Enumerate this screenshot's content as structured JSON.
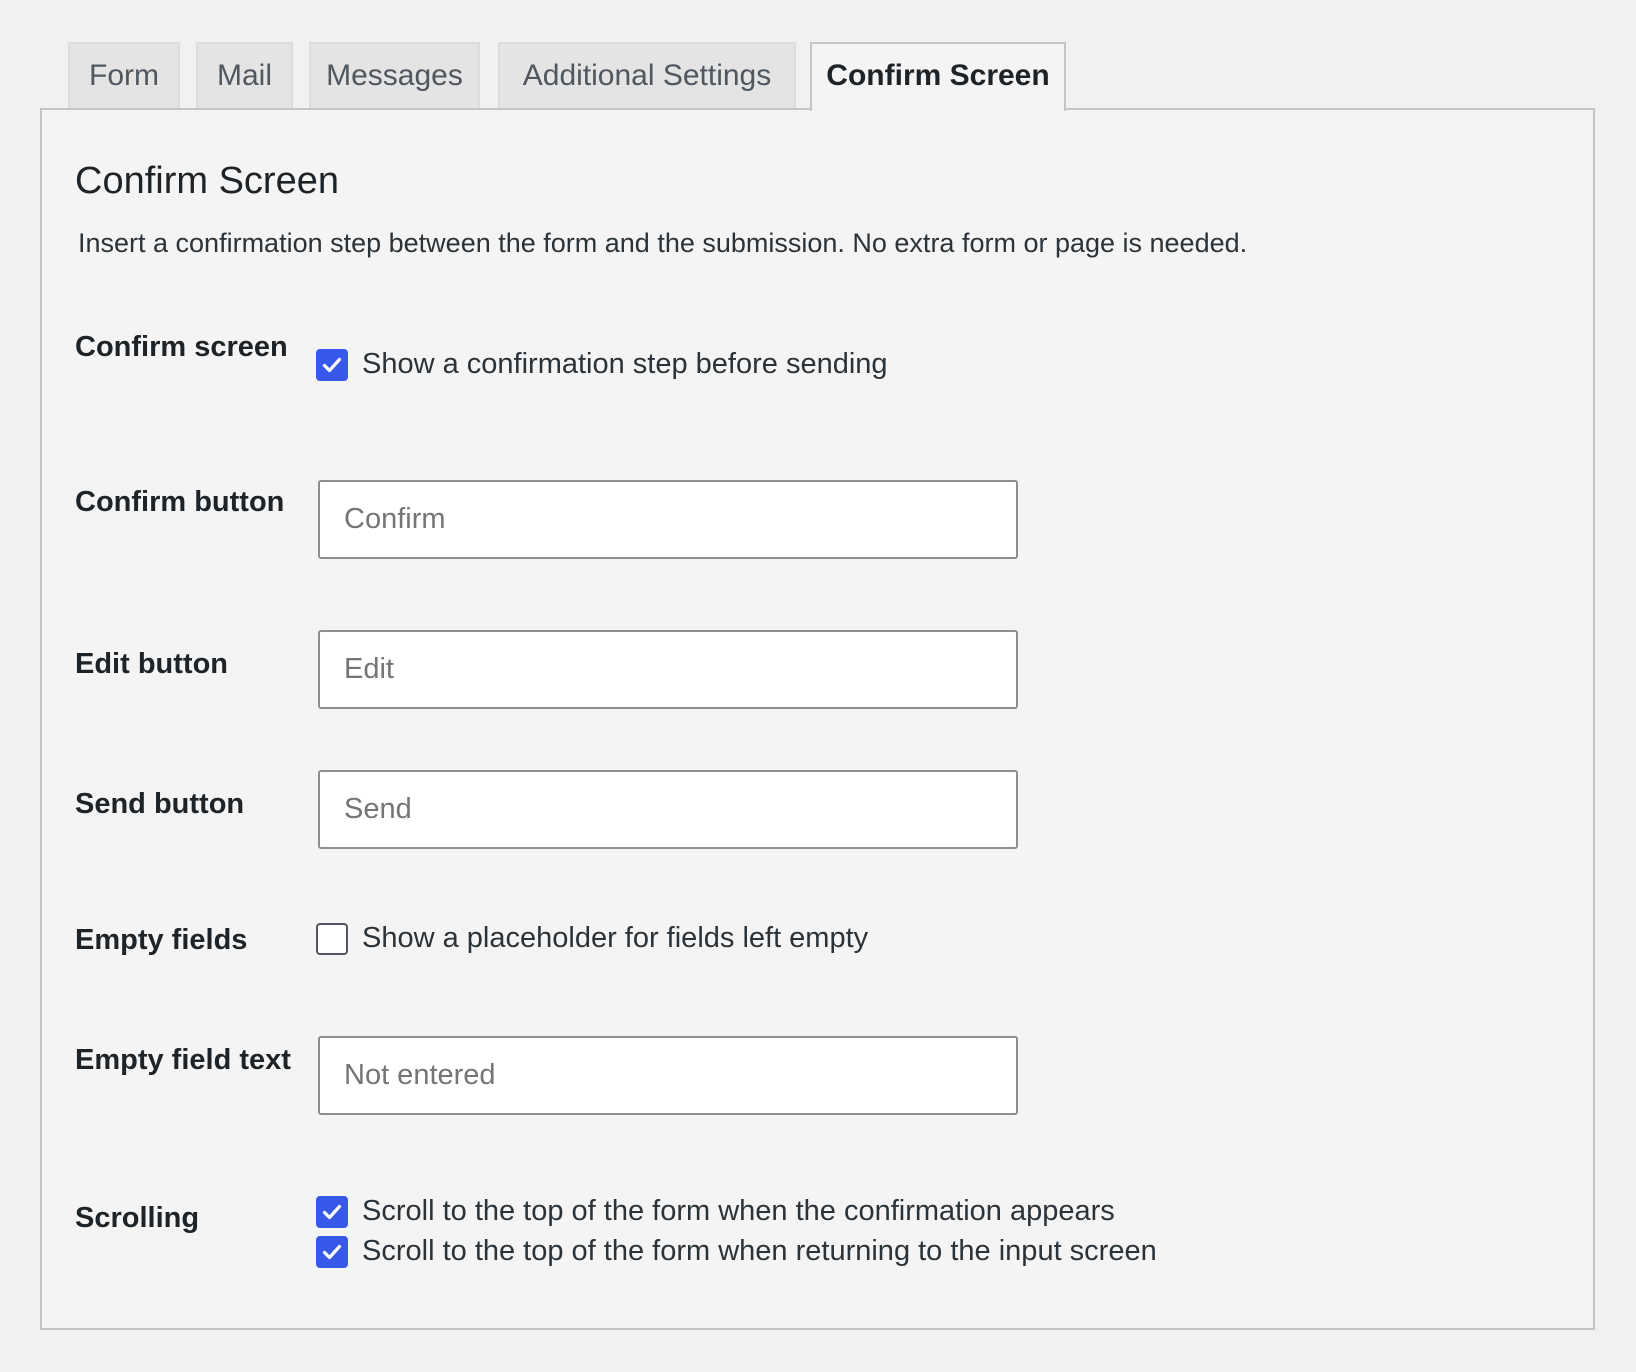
{
  "tabs": [
    {
      "label": "Form",
      "active": false
    },
    {
      "label": "Mail",
      "active": false
    },
    {
      "label": "Messages",
      "active": false
    },
    {
      "label": "Additional Settings",
      "active": false
    },
    {
      "label": "Confirm Screen",
      "active": true
    }
  ],
  "panel": {
    "title": "Confirm Screen",
    "description": "Insert a confirmation step between the form and the submission. No extra form or page is needed."
  },
  "fields": {
    "confirm_screen": {
      "label": "Confirm screen",
      "option": "Show a confirmation step before sending",
      "checked": true
    },
    "confirm_button": {
      "label": "Confirm button",
      "placeholder": "Confirm",
      "value": ""
    },
    "edit_button": {
      "label": "Edit button",
      "placeholder": "Edit",
      "value": ""
    },
    "send_button": {
      "label": "Send button",
      "placeholder": "Send",
      "value": ""
    },
    "empty_fields": {
      "label": "Empty fields",
      "option": "Show a placeholder for fields left empty",
      "checked": false
    },
    "empty_field_text": {
      "label": "Empty field text",
      "placeholder": "Not entered",
      "value": ""
    },
    "scrolling": {
      "label": "Scrolling",
      "options": [
        {
          "label": "Scroll to the top of the form when the confirmation appears",
          "checked": true
        },
        {
          "label": "Scroll to the top of the form when returning to the input screen",
          "checked": true
        }
      ]
    }
  },
  "colors": {
    "accent": "#3858e9",
    "page_background": "#f1f1f1",
    "panel_background": "#f4f4f4",
    "inactive_tab": "#e4e4e4"
  },
  "icons": {
    "checkmark": "check-icon"
  }
}
